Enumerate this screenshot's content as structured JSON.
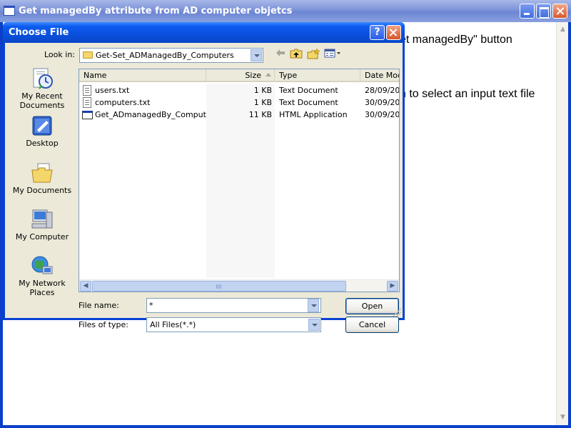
{
  "main_window": {
    "title": "Get managedBy attribute from AD computer objetcs",
    "text_line_1": "et managedBy\" button",
    "text_line_2": "n to select an input text file"
  },
  "dialog": {
    "title": "Choose File",
    "help_label": "?",
    "look_in_label": "Look in:",
    "look_in_value": "Get-Set_ADManagedBy_Computers",
    "places": [
      {
        "label": "My Recent Documents",
        "icon": "recent-documents-icon"
      },
      {
        "label": "Desktop",
        "icon": "desktop-icon"
      },
      {
        "label": "My Documents",
        "icon": "my-documents-icon"
      },
      {
        "label": "My Computer",
        "icon": "my-computer-icon"
      },
      {
        "label": "My Network Places",
        "icon": "network-places-icon"
      }
    ],
    "toolbar": {
      "back_icon": "back-arrow-icon",
      "up_icon": "up-folder-icon",
      "new_folder_icon": "new-folder-icon",
      "views_icon": "views-menu-icon"
    },
    "columns": {
      "name": "Name",
      "size": "Size",
      "type": "Type",
      "date": "Date Mod"
    },
    "files": [
      {
        "name": "users.txt",
        "size": "1 KB",
        "type": "Text Document",
        "date": "28/09/20",
        "icon": "text-file-icon"
      },
      {
        "name": "computers.txt",
        "size": "1 KB",
        "type": "Text Document",
        "date": "30/09/20",
        "icon": "text-file-icon"
      },
      {
        "name": "Get_ADmanagedBy_Compute...",
        "size": "11 KB",
        "type": "HTML Application",
        "date": "30/09/20",
        "icon": "hta-file-icon"
      }
    ],
    "file_name_label": "File name:",
    "file_name_value": "*",
    "files_of_type_label": "Files of type:",
    "files_of_type_value": "All Files(*.*)",
    "open_label": "Open",
    "cancel_label": "Cancel"
  }
}
